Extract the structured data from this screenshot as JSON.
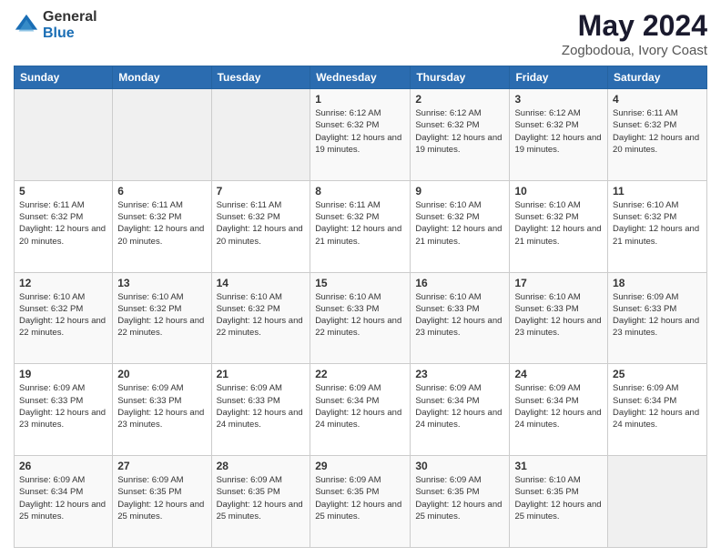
{
  "logo": {
    "general": "General",
    "blue": "Blue"
  },
  "header": {
    "title": "May 2024",
    "subtitle": "Zogbodoua, Ivory Coast"
  },
  "weekdays": [
    "Sunday",
    "Monday",
    "Tuesday",
    "Wednesday",
    "Thursday",
    "Friday",
    "Saturday"
  ],
  "weeks": [
    [
      {
        "day": "",
        "info": ""
      },
      {
        "day": "",
        "info": ""
      },
      {
        "day": "",
        "info": ""
      },
      {
        "day": "1",
        "info": "Sunrise: 6:12 AM\nSunset: 6:32 PM\nDaylight: 12 hours\nand 19 minutes."
      },
      {
        "day": "2",
        "info": "Sunrise: 6:12 AM\nSunset: 6:32 PM\nDaylight: 12 hours\nand 19 minutes."
      },
      {
        "day": "3",
        "info": "Sunrise: 6:12 AM\nSunset: 6:32 PM\nDaylight: 12 hours\nand 19 minutes."
      },
      {
        "day": "4",
        "info": "Sunrise: 6:11 AM\nSunset: 6:32 PM\nDaylight: 12 hours\nand 20 minutes."
      }
    ],
    [
      {
        "day": "5",
        "info": "Sunrise: 6:11 AM\nSunset: 6:32 PM\nDaylight: 12 hours\nand 20 minutes."
      },
      {
        "day": "6",
        "info": "Sunrise: 6:11 AM\nSunset: 6:32 PM\nDaylight: 12 hours\nand 20 minutes."
      },
      {
        "day": "7",
        "info": "Sunrise: 6:11 AM\nSunset: 6:32 PM\nDaylight: 12 hours\nand 20 minutes."
      },
      {
        "day": "8",
        "info": "Sunrise: 6:11 AM\nSunset: 6:32 PM\nDaylight: 12 hours\nand 21 minutes."
      },
      {
        "day": "9",
        "info": "Sunrise: 6:10 AM\nSunset: 6:32 PM\nDaylight: 12 hours\nand 21 minutes."
      },
      {
        "day": "10",
        "info": "Sunrise: 6:10 AM\nSunset: 6:32 PM\nDaylight: 12 hours\nand 21 minutes."
      },
      {
        "day": "11",
        "info": "Sunrise: 6:10 AM\nSunset: 6:32 PM\nDaylight: 12 hours\nand 21 minutes."
      }
    ],
    [
      {
        "day": "12",
        "info": "Sunrise: 6:10 AM\nSunset: 6:32 PM\nDaylight: 12 hours\nand 22 minutes."
      },
      {
        "day": "13",
        "info": "Sunrise: 6:10 AM\nSunset: 6:32 PM\nDaylight: 12 hours\nand 22 minutes."
      },
      {
        "day": "14",
        "info": "Sunrise: 6:10 AM\nSunset: 6:32 PM\nDaylight: 12 hours\nand 22 minutes."
      },
      {
        "day": "15",
        "info": "Sunrise: 6:10 AM\nSunset: 6:33 PM\nDaylight: 12 hours\nand 22 minutes."
      },
      {
        "day": "16",
        "info": "Sunrise: 6:10 AM\nSunset: 6:33 PM\nDaylight: 12 hours\nand 23 minutes."
      },
      {
        "day": "17",
        "info": "Sunrise: 6:10 AM\nSunset: 6:33 PM\nDaylight: 12 hours\nand 23 minutes."
      },
      {
        "day": "18",
        "info": "Sunrise: 6:09 AM\nSunset: 6:33 PM\nDaylight: 12 hours\nand 23 minutes."
      }
    ],
    [
      {
        "day": "19",
        "info": "Sunrise: 6:09 AM\nSunset: 6:33 PM\nDaylight: 12 hours\nand 23 minutes."
      },
      {
        "day": "20",
        "info": "Sunrise: 6:09 AM\nSunset: 6:33 PM\nDaylight: 12 hours\nand 23 minutes."
      },
      {
        "day": "21",
        "info": "Sunrise: 6:09 AM\nSunset: 6:33 PM\nDaylight: 12 hours\nand 24 minutes."
      },
      {
        "day": "22",
        "info": "Sunrise: 6:09 AM\nSunset: 6:34 PM\nDaylight: 12 hours\nand 24 minutes."
      },
      {
        "day": "23",
        "info": "Sunrise: 6:09 AM\nSunset: 6:34 PM\nDaylight: 12 hours\nand 24 minutes."
      },
      {
        "day": "24",
        "info": "Sunrise: 6:09 AM\nSunset: 6:34 PM\nDaylight: 12 hours\nand 24 minutes."
      },
      {
        "day": "25",
        "info": "Sunrise: 6:09 AM\nSunset: 6:34 PM\nDaylight: 12 hours\nand 24 minutes."
      }
    ],
    [
      {
        "day": "26",
        "info": "Sunrise: 6:09 AM\nSunset: 6:34 PM\nDaylight: 12 hours\nand 25 minutes."
      },
      {
        "day": "27",
        "info": "Sunrise: 6:09 AM\nSunset: 6:35 PM\nDaylight: 12 hours\nand 25 minutes."
      },
      {
        "day": "28",
        "info": "Sunrise: 6:09 AM\nSunset: 6:35 PM\nDaylight: 12 hours\nand 25 minutes."
      },
      {
        "day": "29",
        "info": "Sunrise: 6:09 AM\nSunset: 6:35 PM\nDaylight: 12 hours\nand 25 minutes."
      },
      {
        "day": "30",
        "info": "Sunrise: 6:09 AM\nSunset: 6:35 PM\nDaylight: 12 hours\nand 25 minutes."
      },
      {
        "day": "31",
        "info": "Sunrise: 6:10 AM\nSunset: 6:35 PM\nDaylight: 12 hours\nand 25 minutes."
      },
      {
        "day": "",
        "info": ""
      }
    ]
  ]
}
